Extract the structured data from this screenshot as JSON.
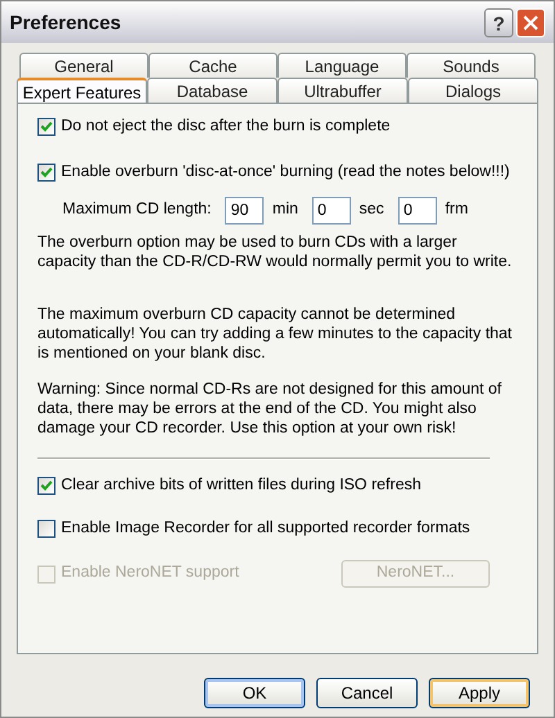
{
  "window": {
    "title": "Preferences",
    "help": "?"
  },
  "tab_rows": [
    [
      {
        "label": "General",
        "selected": false
      },
      {
        "label": "Cache",
        "selected": false
      },
      {
        "label": "Language",
        "selected": false
      },
      {
        "label": "Sounds",
        "selected": false
      }
    ],
    [
      {
        "label": "Expert Features",
        "selected": true
      },
      {
        "label": "Database",
        "selected": false
      },
      {
        "label": "Ultrabuffer",
        "selected": false
      },
      {
        "label": "Dialogs",
        "selected": false
      }
    ]
  ],
  "overburn_options": [
    {
      "label": "Do not eject the disc after the burn is complete",
      "checked": true
    },
    {
      "label": "Enable overburn 'disc-at-once' burning (read the notes below!!!)",
      "checked": true
    }
  ],
  "cd_length": {
    "label": "Maximum CD length:",
    "fields": [
      {
        "value": "90",
        "unit": "min"
      },
      {
        "value": "0",
        "unit": "sec"
      },
      {
        "value": "0",
        "unit": "frm"
      }
    ]
  },
  "notes": [
    "The overburn option may be used to burn CDs with a larger capacity than the CD-R/CD-RW would normally permit you to write.",
    "The maximum overburn CD capacity cannot be determined automatically! You can try adding a few minutes to the capacity that is mentioned on your blank disc.",
    "Warning: Since normal CD-Rs are not designed for this amount of data, there may be errors at the end of the CD. You might also damage your CD recorder. Use this option at your own risk!"
  ],
  "other_options": [
    {
      "label": "Clear archive bits of written files during ISO refresh",
      "checked": true,
      "disabled": false
    },
    {
      "label": "Enable Image Recorder for all supported recorder formats",
      "checked": false,
      "disabled": false
    },
    {
      "label": "Enable NeroNET support",
      "checked": false,
      "disabled": true,
      "button": {
        "label": "NeroNET...",
        "disabled": true
      }
    }
  ],
  "buttons": [
    {
      "label": "OK",
      "kind": "default"
    },
    {
      "label": "Cancel",
      "kind": "normal"
    },
    {
      "label": "Apply",
      "kind": "focused"
    }
  ]
}
